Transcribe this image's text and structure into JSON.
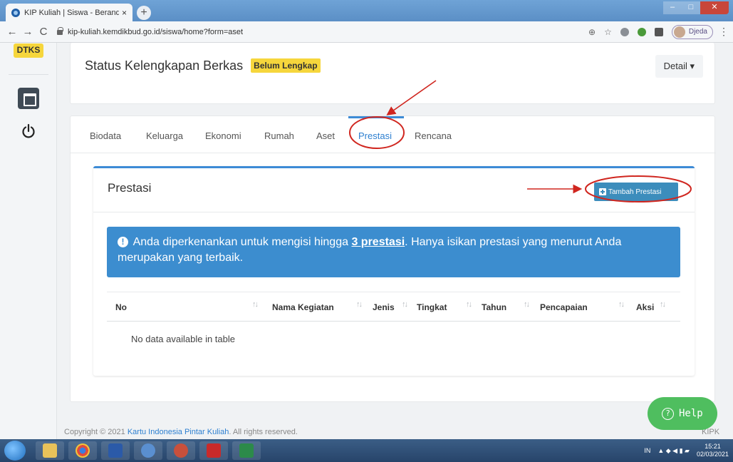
{
  "browser": {
    "tab_title": "KIP Kuliah | Siswa - Beranda",
    "tab_close": "×",
    "new_tab": "+",
    "url": "kip-kuliah.kemdikbud.go.id/siswa/home?form=aset",
    "profile_name": "Djeda",
    "nav_back": "←",
    "nav_forward": "→",
    "nav_reload": "C",
    "zoom_icon": "⊕",
    "star_icon": "☆",
    "menu": "⋮"
  },
  "sidebar": {
    "badge": "DTKS"
  },
  "status": {
    "title": "Status Kelengkapan Berkas",
    "badge": "Belum Lengkap",
    "detail_button": "Detail ▾"
  },
  "tabs": [
    {
      "label": "Biodata"
    },
    {
      "label": "Keluarga"
    },
    {
      "label": "Ekonomi"
    },
    {
      "label": "Rumah"
    },
    {
      "label": "Aset"
    },
    {
      "label": "Prestasi",
      "active": true
    },
    {
      "label": "Rencana"
    }
  ],
  "prestasi": {
    "title": "Prestasi",
    "add_button": "Tambah Prestasi",
    "alert": {
      "icon": "!",
      "text_before": "Anda diperkenankan untuk mengisi hingga ",
      "highlight": "3 prestasi",
      "text_after": ". Hanya isikan prestasi yang menurut Anda merupakan yang terbaik."
    },
    "columns": [
      "No",
      "Nama Kegiatan",
      "Jenis",
      "Tingkat",
      "Tahun",
      "Pencapaian",
      "Aksi"
    ],
    "sort_glyph": "↑↓",
    "empty_text": "No data available in table"
  },
  "footer": {
    "copyright": "Copyright © 2021 ",
    "link": "Kartu Indonesia Pintar Kuliah",
    "rest": ". All rights reserved.",
    "right": "KIPK"
  },
  "help": {
    "icon": "?",
    "label": "Help"
  },
  "taskbar": {
    "lang": "IN",
    "time": "15:21",
    "date": "02/03/2021"
  },
  "colors": {
    "accent": "#3c8dbc",
    "alert_bg": "#3c8dcf",
    "badge_yellow": "#f6d63c",
    "help_green": "#4fbe5f",
    "annotation_red": "#d0261f"
  }
}
